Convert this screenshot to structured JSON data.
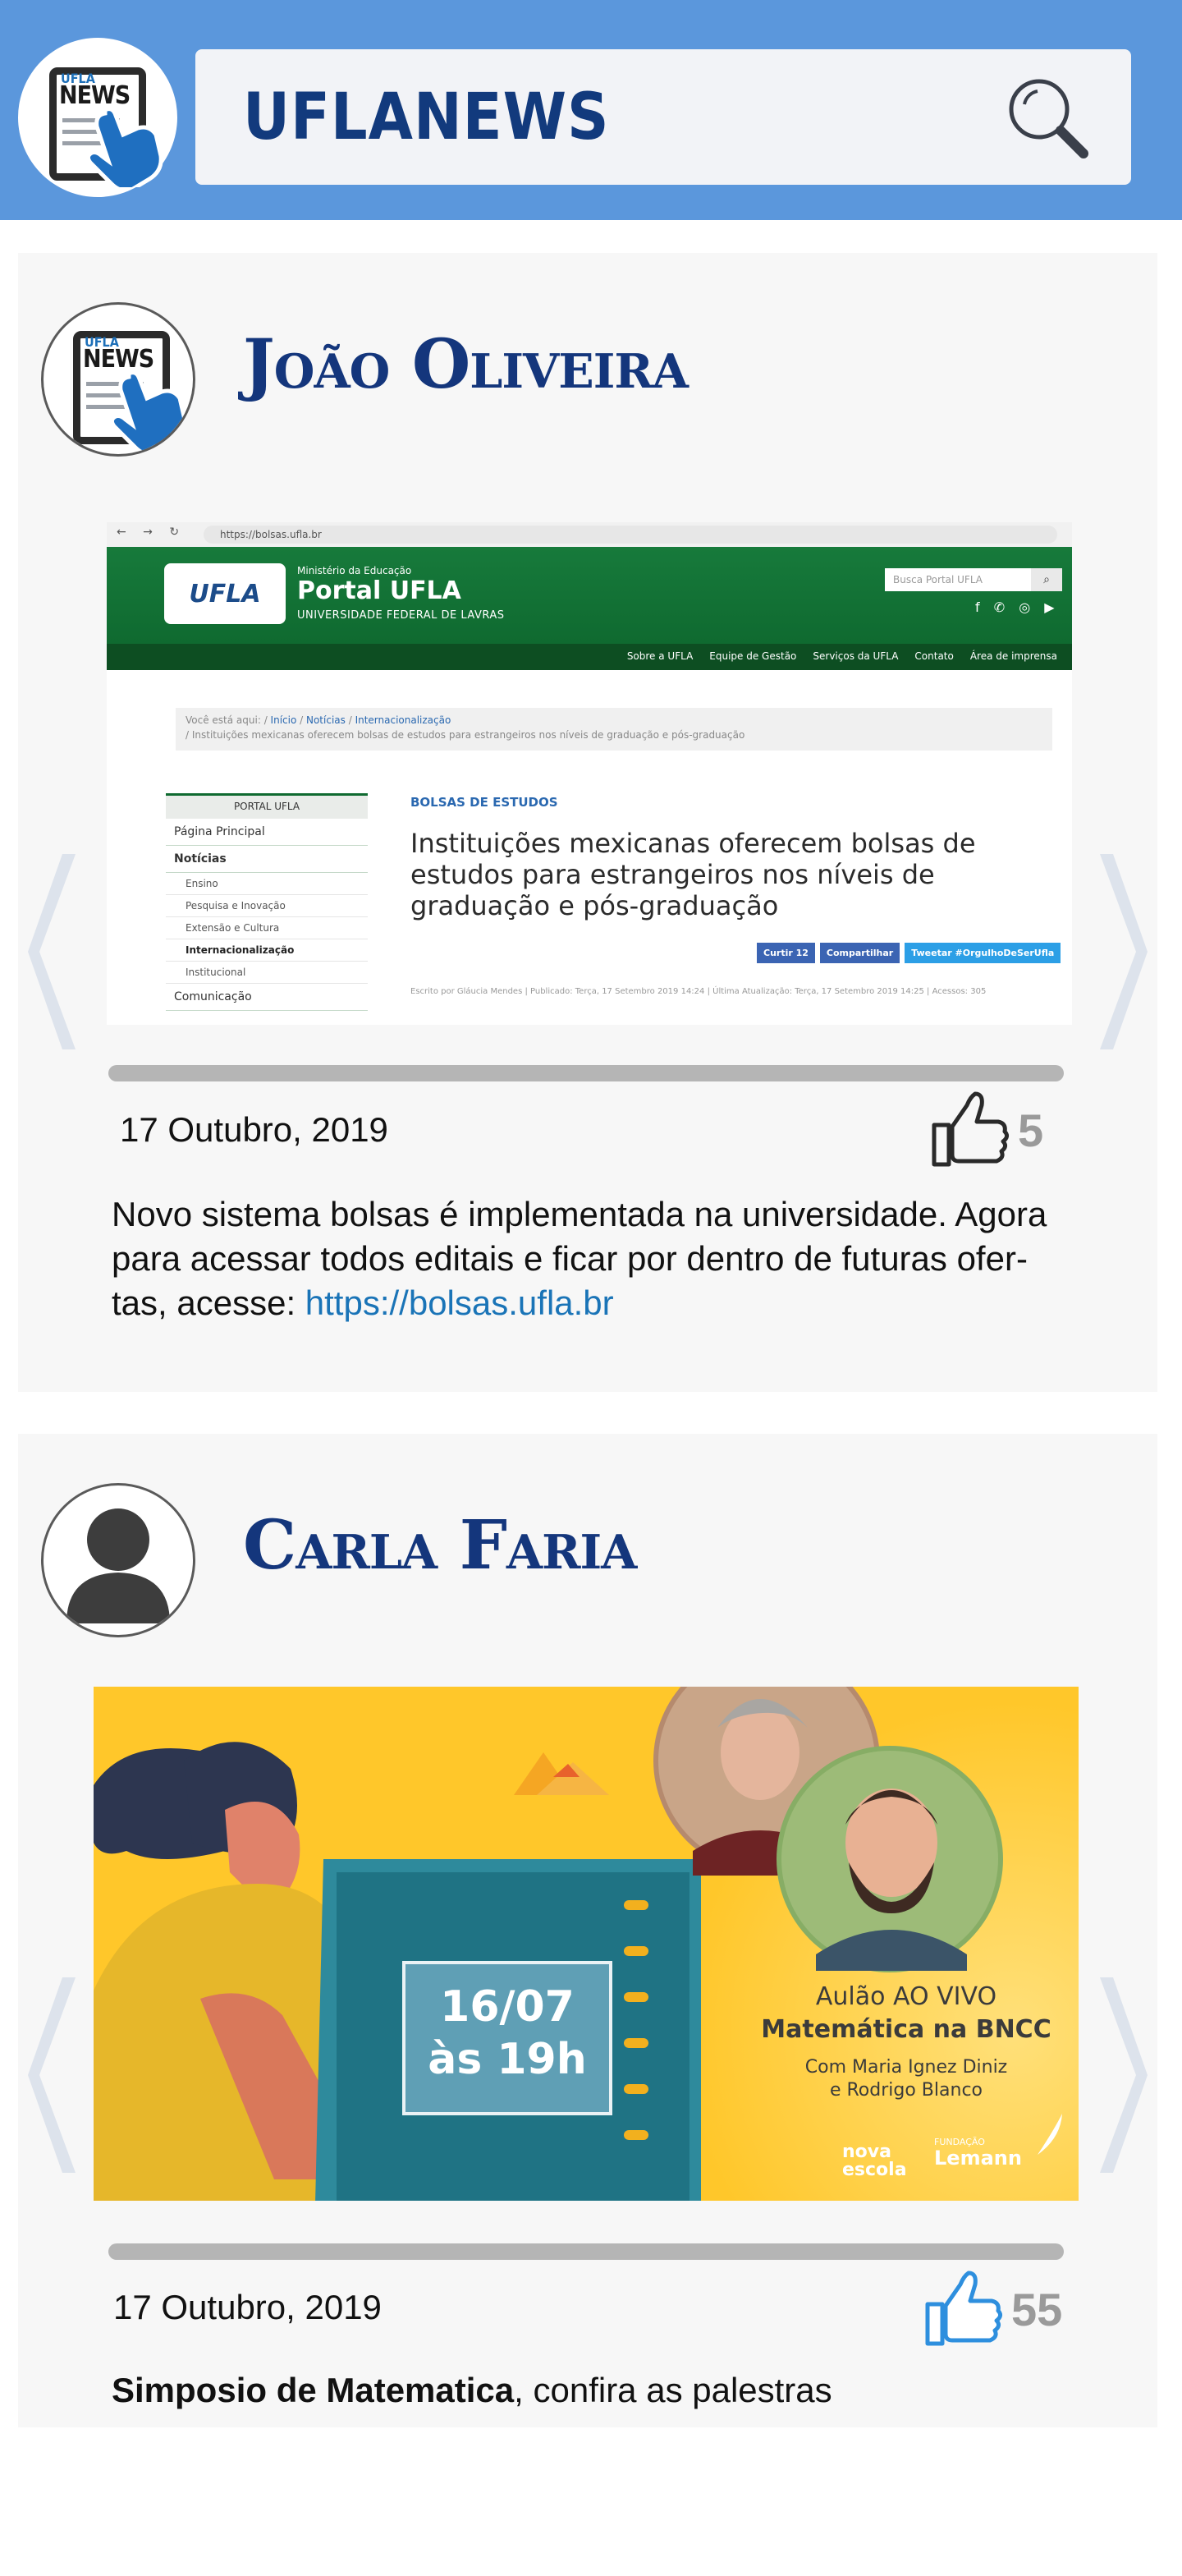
{
  "app": {
    "title": "UFLANEWS",
    "logo_small": "UFLA",
    "logo_big": "NEWS"
  },
  "posts": [
    {
      "author": "João Oliveira",
      "date": "17 Outubro, 2019",
      "likes": "5",
      "progress": 1.0,
      "text_before": "Novo sistema bolsas é implementada na universidade. Agora para acessar todos editais e ficar por dentro de futuras ofer-tas, acesse: ",
      "link": "https://bolsas.ufla.br",
      "screenshot": {
        "url": "https://bolsas.ufla.br",
        "logo_text": "UFLA",
        "ministry": "Ministério da Educação",
        "portal_name": "Portal UFLA",
        "portal_sub": "UNIVERSIDADE FEDERAL DE LAVRAS",
        "search_placeholder": "Busca Portal UFLA",
        "menu": [
          "Sobre a UFLA",
          "Equipe de Gestão",
          "Serviços da UFLA",
          "Contato",
          "Área de imprensa"
        ],
        "breadcrumb_lead": "Você está aqui:",
        "breadcrumb": [
          "Início",
          "Notícias",
          "Internacionalização"
        ],
        "breadcrumb_tail": "Instituições mexicanas oferecem bolsas de estudos para estrangeiros nos níveis de graduação e pós-graduação",
        "sidebar_head": "PORTAL UFLA",
        "sidebar_items": [
          "Página Principal",
          "Notícias"
        ],
        "sidebar_sub": [
          "Ensino",
          "Pesquisa e Inovação",
          "Extensão e Cultura",
          "Internacionalização",
          "Institucional"
        ],
        "sidebar_last": "Comunicação",
        "category": "BOLSAS DE ESTUDOS",
        "title": "Instituições mexicanas oferecem bolsas de estudos para estrangeiros nos níveis de graduação e pós-graduação",
        "buttons": [
          "Curtir 12",
          "Compartilhar",
          "Tweetar #OrgulhoDeSerUfla"
        ],
        "meta": "Escrito por Gláucia Mendes | Publicado: Terça, 17 Setembro 2019 14:24 | Última Atualização: Terça, 17 Setembro 2019 14:25 | Acessos: 305"
      }
    },
    {
      "author": "Carla Faria",
      "date": "17 Outubro, 2019",
      "likes": "55",
      "progress": 1.0,
      "text_bold": "Simposio de Matematica",
      "text_rest": ", confira as palestras",
      "banner": {
        "date_line1": "16/07",
        "date_line2": "às 19h",
        "line1": "Aulão AO VIVO",
        "line2": "Matemática na BNCC",
        "line3": "Com Maria Ignez Diniz",
        "line4": "e Rodrigo Blanco",
        "brand1a": "nova",
        "brand1b": "escola",
        "brand2a": "FUNDAÇÃO",
        "brand2b": "Lemann"
      }
    }
  ],
  "icons": {
    "search": "search-icon",
    "like": "thumbs-up-icon",
    "prev": "chevron-left-icon",
    "next": "chevron-right-icon",
    "avatar_placeholder": "user-silhouette-icon"
  },
  "colors": {
    "header": "#5b97dc",
    "title": "#123a7d",
    "author": "#14367c",
    "link": "#1a74b7",
    "like_active": "#2e8fde"
  }
}
